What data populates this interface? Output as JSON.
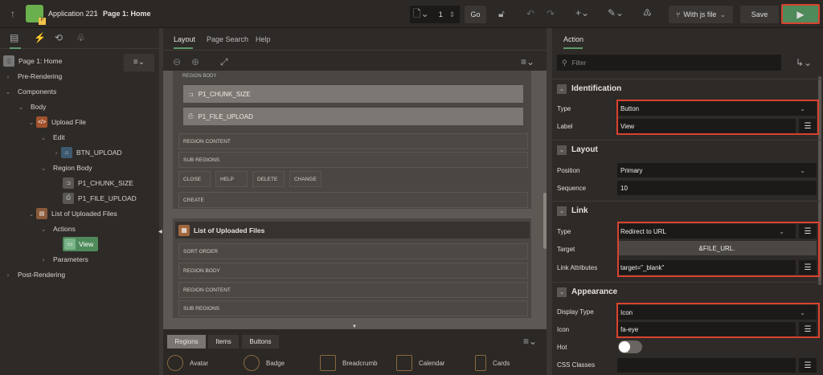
{
  "header": {
    "app": "Application 221",
    "page": "Page 1: Home",
    "page_number": "1",
    "go": "Go",
    "branch": "With js file",
    "save": "Save"
  },
  "left": {
    "tree": [
      {
        "label": "Page 1: Home"
      },
      {
        "label": "Pre-Rendering"
      },
      {
        "label": "Components"
      },
      {
        "label": "Body"
      },
      {
        "label": "Upload File"
      },
      {
        "label": "Edit"
      },
      {
        "label": "BTN_UPLOAD"
      },
      {
        "label": "Region Body"
      },
      {
        "label": "P1_CHUNK_SIZE"
      },
      {
        "label": "P1_FILE_UPLOAD"
      },
      {
        "label": "List of Uploaded Files"
      },
      {
        "label": "Actions"
      },
      {
        "label": "View"
      },
      {
        "label": "Parameters"
      },
      {
        "label": "Post-Rendering"
      }
    ]
  },
  "middle": {
    "tabs": [
      "Layout",
      "Page Search",
      "Help"
    ],
    "region1": {
      "region_body": "REGION BODY",
      "items": [
        "P1_CHUNK_SIZE",
        "P1_FILE_UPLOAD"
      ],
      "region_content": "REGION CONTENT",
      "sub_regions": "SUB REGIONS",
      "buttons": [
        "CLOSE",
        "HELP",
        "DELETE",
        "CHANGE"
      ],
      "create": "CREATE"
    },
    "region2": {
      "title": "List of Uploaded Files",
      "slots": [
        "SORT ORDER",
        "REGION BODY",
        "REGION CONTENT",
        "SUB REGIONS"
      ]
    },
    "gallery": {
      "tabs": [
        "Regions",
        "Items",
        "Buttons"
      ],
      "items": [
        "Avatar",
        "Badge",
        "Breadcrumb",
        "Calendar",
        "Cards"
      ]
    }
  },
  "right": {
    "tab": "Action",
    "filter_placeholder": "Filter",
    "sections": {
      "identification": {
        "title": "Identification",
        "type_label": "Type",
        "type": "Button",
        "label_label": "Label",
        "label": "View"
      },
      "layout": {
        "title": "Layout",
        "position_label": "Position",
        "position": "Primary",
        "sequence_label": "Sequence",
        "sequence": "10"
      },
      "link": {
        "title": "Link",
        "type_label": "Type",
        "type": "Redirect to URL",
        "target_label": "Target",
        "target": "&FILE_URL.",
        "attrs_label": "Link Attributes",
        "attrs": "target=\"_blank\""
      },
      "appearance": {
        "title": "Appearance",
        "display_label": "Display Type",
        "display": "Icon",
        "icon_label": "Icon",
        "icon": "fa-eye",
        "hot_label": "Hot",
        "hot": false,
        "css_label": "CSS Classes",
        "css": ""
      }
    }
  },
  "colors": {
    "accent": "#4f8a5b",
    "highlight": "#d9432f"
  }
}
